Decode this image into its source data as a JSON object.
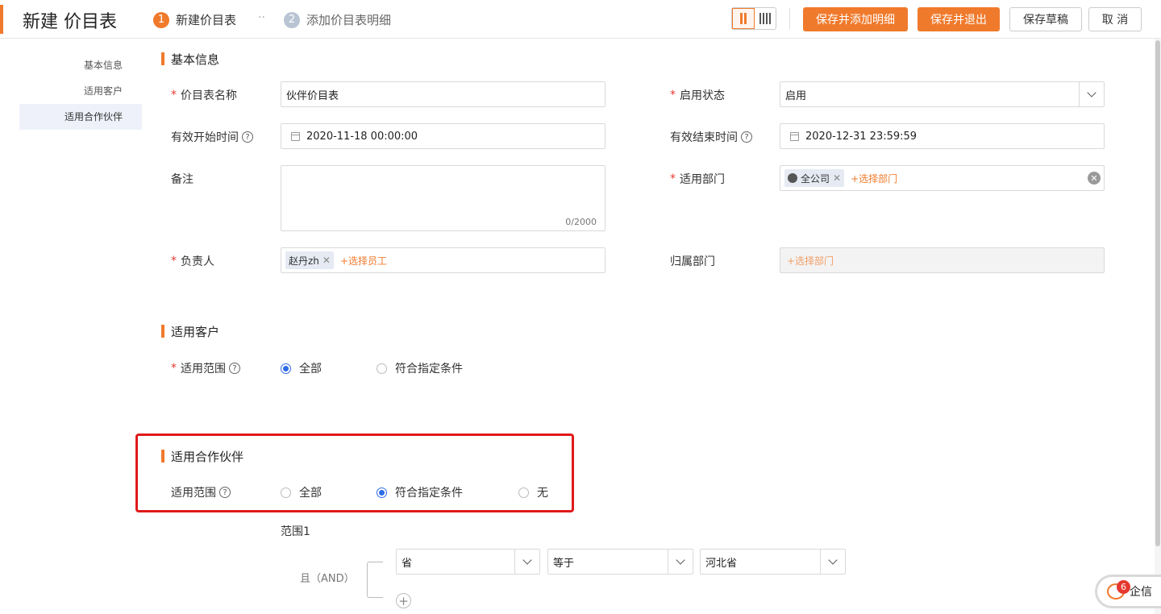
{
  "header": {
    "title": "新建 价目表",
    "steps": [
      {
        "num": "1",
        "label": "新建价目表"
      },
      {
        "num": "2",
        "label": "添加价目表明细"
      }
    ],
    "step_separator": "··",
    "buttons": {
      "save_add_detail": "保存并添加明细",
      "save_exit": "保存并退出",
      "save_draft": "保存草稿",
      "cancel": "取 消"
    }
  },
  "nav": {
    "items": [
      "基本信息",
      "适用客户",
      "适用合作伙伴"
    ]
  },
  "basic": {
    "title": "基本信息",
    "name_label": "价目表名称",
    "name_value": "伙伴价目表",
    "status_label": "启用状态",
    "status_value": "启用",
    "start_label": "有效开始时间",
    "start_value": "2020-11-18 00:00:00",
    "end_label": "有效结束时间",
    "end_value": "2020-12-31 23:59:59",
    "remark_label": "备注",
    "remark_counter": "0/2000",
    "dept_label": "适用部门",
    "dept_tag": "全公司",
    "dept_add": "+选择部门",
    "owner_label": "负责人",
    "owner_tag": "赵丹zh",
    "owner_add": "+选择员工",
    "belong_label": "归属部门",
    "belong_add": "+选择部门"
  },
  "customer": {
    "title": "适用客户",
    "range_label": "适用范围",
    "options": [
      "全部",
      "符合指定条件"
    ],
    "selected": 0
  },
  "partner": {
    "title": "适用合作伙伴",
    "range_label": "适用范围",
    "options": [
      "全部",
      "符合指定条件",
      "无"
    ],
    "selected": 1,
    "scope_title": "范围1",
    "logic": "且（AND）",
    "condition": {
      "field": "省",
      "operator": "等于",
      "value": "河北省"
    }
  },
  "qixin": {
    "label": "企信",
    "badge": "6"
  },
  "icons": {
    "help": "help-icon",
    "calendar": "calendar-icon",
    "chevron": "chevron-down-icon",
    "clear": "clear-icon",
    "chat": "chat-bubble-icon",
    "add": "add-icon"
  },
  "colors": {
    "accent": "#f07a2c",
    "radio": "#2f6ce5",
    "required": "#e6382f",
    "highlight": "#e01a1a"
  }
}
